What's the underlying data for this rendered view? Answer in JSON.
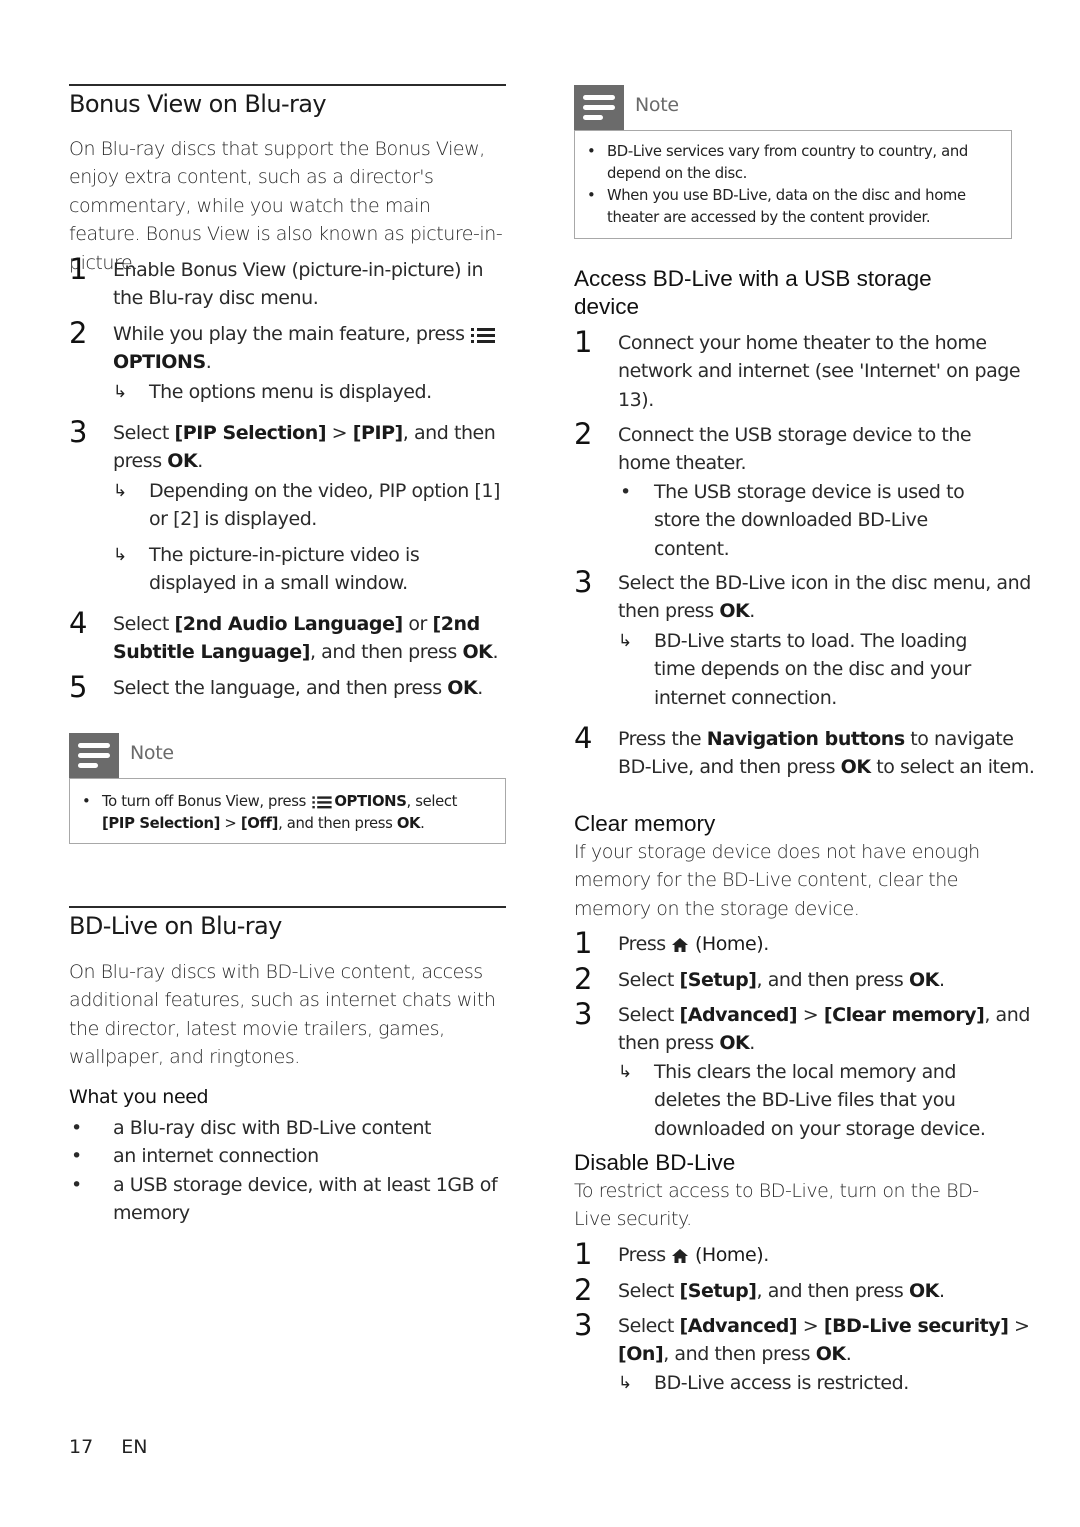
{
  "page": {
    "number": "17",
    "language": "EN"
  },
  "bonus_view": {
    "title": "Bonus View on Blu-ray",
    "intro": "On Blu-ray discs that support the Bonus View, enjoy extra content, such as a director's commentary, while you watch the main feature. Bonus View is also known as picture-in-picture.",
    "steps": [
      {
        "num": "1",
        "text": "Enable Bonus View (picture-in-picture) in the Blu-ray disc menu."
      },
      {
        "num": "2",
        "text_before": "While you play the main feature, press",
        "icon": "options-icon",
        "text_bold": "OPTIONS",
        "text_after": ".",
        "result": "The options menu is displayed."
      },
      {
        "num": "3",
        "text_before": "Select",
        "b1": "[PIP Selection]",
        "sep": ">",
        "b2": "[PIP]",
        "text_mid": ", and then press",
        "b3": "OK",
        "text_after": ".",
        "results": [
          "Depending on the video, PIP option [1] or [2] is displayed.",
          "The picture-in-picture video is displayed in a small window."
        ]
      },
      {
        "num": "4",
        "text_before": "Select",
        "b1": "[2nd Audio Language]",
        "text_mid": "or",
        "b2": "[2nd Subtitle Language]",
        "text_mid2": ", and then press",
        "b3": "OK",
        "text_after": "."
      },
      {
        "num": "5",
        "text_before": "Select the language, and then press",
        "b1": "OK",
        "text_after": "."
      }
    ],
    "note": {
      "label": "Note",
      "icon": "note-icon",
      "item": {
        "t1": "To turn off Bonus View, press",
        "icon": "options-icon",
        "b1": "OPTIONS",
        "t2": ", select",
        "b2": "[PIP Selection]",
        "t3": ">",
        "b3": "[Off]",
        "t4": ", and then press",
        "b4": "OK",
        "t5": "."
      }
    }
  },
  "bd_live": {
    "title": "BD-Live on Blu-ray",
    "intro": "On Blu-ray discs with BD-Live content, access additional features, such as internet chats with the director, latest movie trailers, games, wallpaper, and ringtones.",
    "need_title": "What you need",
    "needs": [
      "a Blu-ray disc with BD-Live content",
      "an internet connection",
      "a USB storage device, with at least 1GB of memory"
    ],
    "note": {
      "label": "Note",
      "icon": "note-icon",
      "items": [
        "BD-Live services vary from country to country, and depend on the disc.",
        "When you use BD-Live, data on the disc and home theater are accessed by the content provider."
      ]
    },
    "usb": {
      "title": "Access BD-Live with a USB storage device",
      "steps": [
        {
          "num": "1",
          "text": "Connect your home theater to the home network and internet (see 'Internet' on page 13)."
        },
        {
          "num": "2",
          "text": "Connect the USB storage device to the home theater.",
          "bullet": "The USB storage device is used to store the downloaded BD-Live content."
        },
        {
          "num": "3",
          "text_before": "Select the BD-Live icon in the disc menu, and then press",
          "b1": "OK",
          "text_after": ".",
          "result": "BD-Live starts to load. The loading time depends on the disc and your internet connection."
        },
        {
          "num": "4",
          "text_before": "Press the",
          "b1": "Navigation buttons",
          "text_mid": "to navigate BD-Live, and then press",
          "b2": "OK",
          "text_after": "to select an item."
        }
      ]
    },
    "clear_memory": {
      "title": "Clear memory",
      "intro": "If your storage device does not have enough memory for the BD-Live content, clear the memory on the storage device.",
      "steps": [
        {
          "num": "1",
          "text_before": "Press",
          "icon": "home-icon",
          "b1": "(Home)",
          "text_after": "."
        },
        {
          "num": "2",
          "text_before": "Select",
          "b1": "[Setup]",
          "text_mid": ", and then press",
          "b2": "OK",
          "text_after": "."
        },
        {
          "num": "3",
          "text_before": "Select",
          "b1": "[Advanced]",
          "sep": ">",
          "b2": "[Clear memory]",
          "text_mid": ", and then press",
          "b3": "OK",
          "text_after": ".",
          "result": "This clears the local memory and deletes the BD-Live files that you downloaded on your storage device."
        }
      ]
    },
    "disable": {
      "title": "Disable BD-Live",
      "intro": "To restrict access to BD-Live, turn on the BD-Live security.",
      "steps": [
        {
          "num": "1",
          "text_before": "Press",
          "icon": "home-icon",
          "b1": "(Home)",
          "text_after": "."
        },
        {
          "num": "2",
          "text_before": "Select",
          "b1": "[Setup]",
          "text_mid": ", and then press",
          "b2": "OK",
          "text_after": "."
        },
        {
          "num": "3",
          "text_before": "Select",
          "b1": "[Advanced]",
          "sep": ">",
          "b2": "[BD-Live security]",
          "sep2": ">",
          "b3": "[On]",
          "text_mid": ", and then press",
          "b4": "OK",
          "text_after": ".",
          "result": "BD-Live access is restricted."
        }
      ]
    }
  },
  "glyphs": {
    "arrow": "↳",
    "bullet": "•"
  },
  "colors": {
    "note_icon_bg": "#6b6b6b",
    "note_border": "#a8a8a8",
    "text": "#2a2a2a"
  }
}
